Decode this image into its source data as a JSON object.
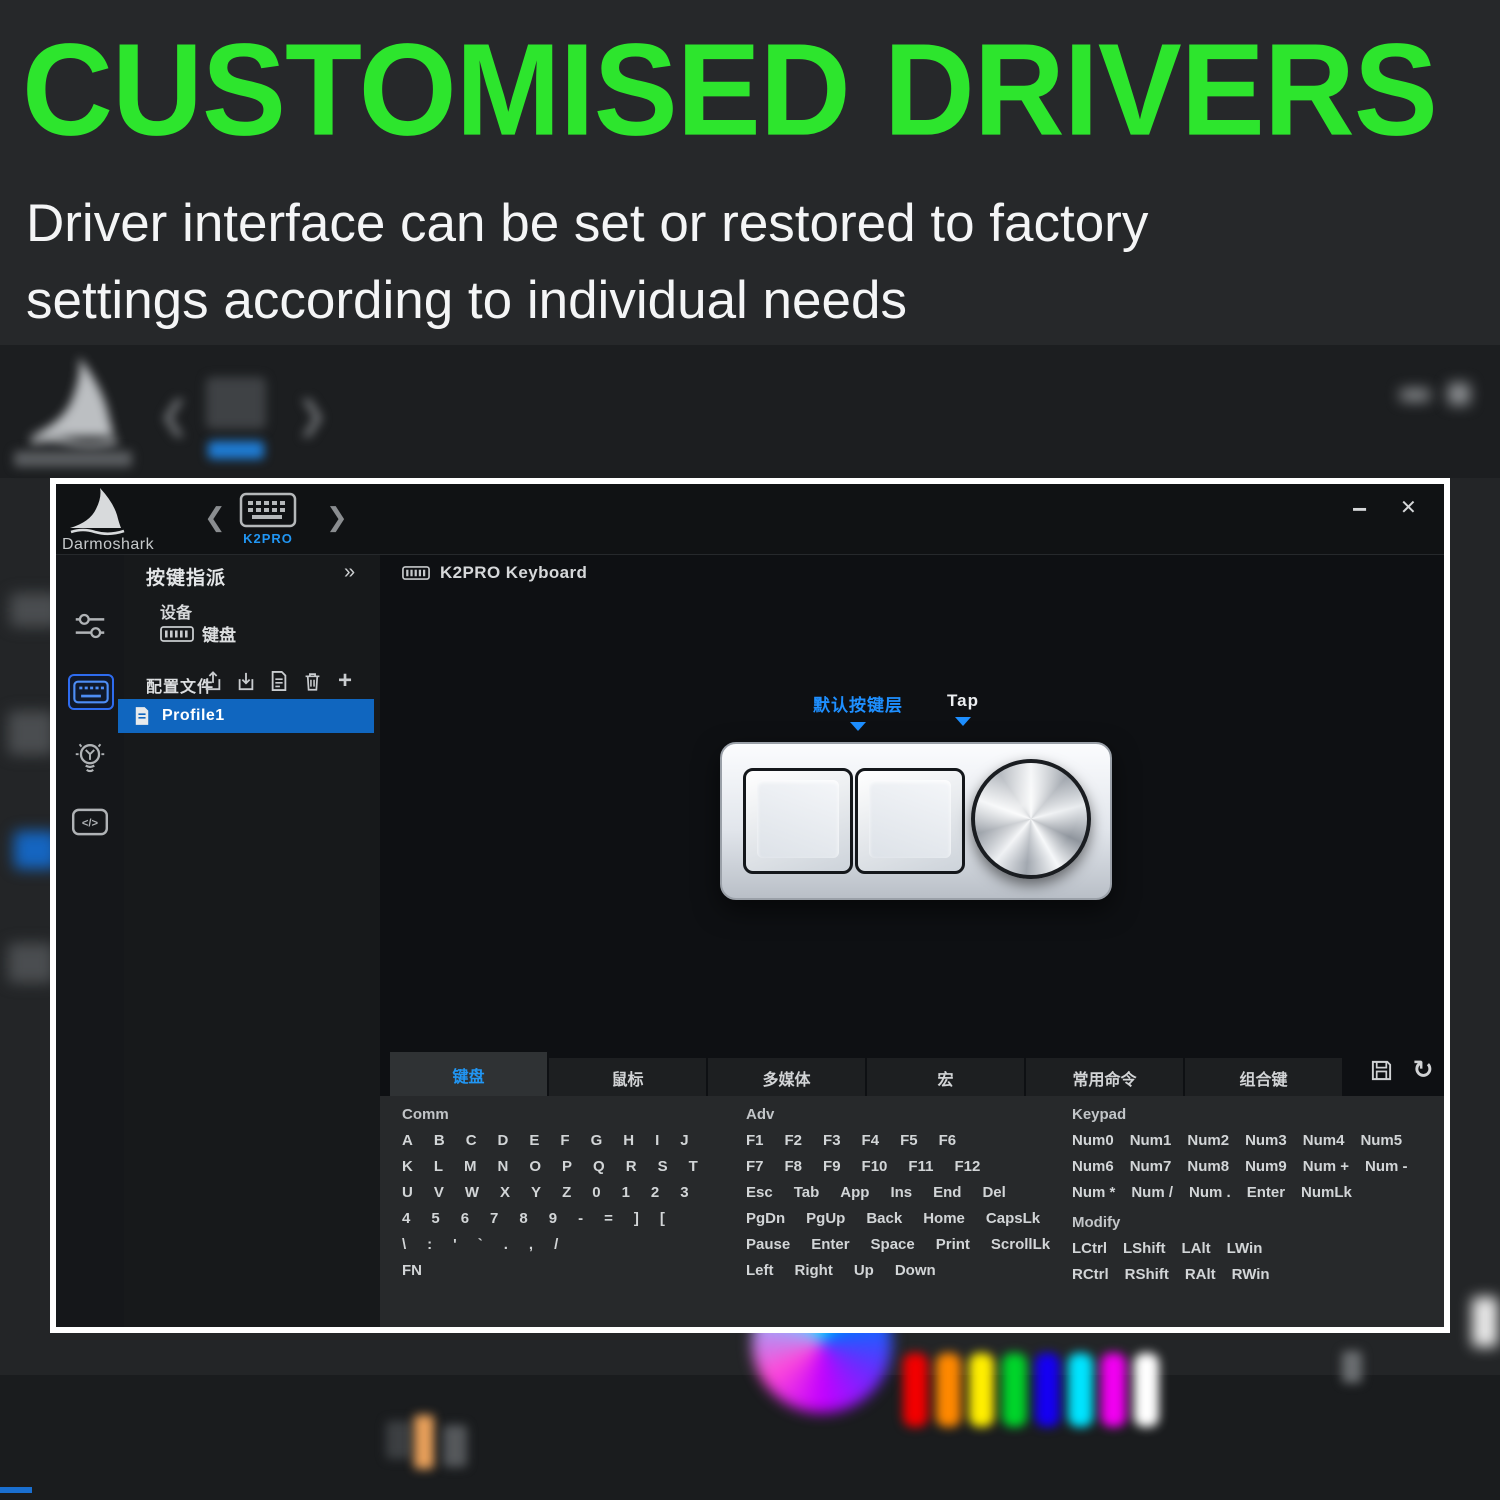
{
  "hero": {
    "headline": "CUSTOMISED DRIVERS",
    "subtitle_line1": "Driver interface can be set or restored to factory",
    "subtitle_line2": "settings according to individual needs"
  },
  "icons": {
    "prev": "❮",
    "next": "❯",
    "expand": "»",
    "minimize": "−",
    "close": "✕",
    "plus": "+",
    "refresh": "↻",
    "code_glyph": "</>"
  },
  "window": {
    "brand": "Darmoshark",
    "device_tab_label": "K2PRO",
    "panel": {
      "title": "按键指派",
      "device_section": "设备",
      "device_name": "键盘",
      "profiles_label": "配置文件",
      "profile_name": "Profile1"
    },
    "main": {
      "device_title": "K2PRO Keyboard",
      "layer_label": "默认按键层",
      "tap_label": "Tap"
    },
    "tabs": [
      {
        "label": "键盘",
        "active": true
      },
      {
        "label": "鼠标",
        "active": false
      },
      {
        "label": "多媒体",
        "active": false
      },
      {
        "label": "宏",
        "active": false
      },
      {
        "label": "常用命令",
        "active": false
      },
      {
        "label": "组合键",
        "active": false
      }
    ],
    "key_sections": [
      {
        "title": "Comm",
        "rows": [
          [
            "A",
            "B",
            "C",
            "D",
            "E",
            "F",
            "G",
            "H",
            "I",
            "J"
          ],
          [
            "K",
            "L",
            "M",
            "N",
            "O",
            "P",
            "Q",
            "R",
            "S",
            "T"
          ],
          [
            "U",
            "V",
            "W",
            "X",
            "Y",
            "Z",
            "0",
            "1",
            "2",
            "3"
          ],
          [
            "4",
            "5",
            "6",
            "7",
            "8",
            "9",
            "-",
            "=",
            "]",
            "["
          ],
          [
            "\\",
            ":",
            "'",
            "`",
            ".",
            ",",
            "/"
          ],
          [
            "FN"
          ]
        ]
      },
      {
        "title": "Adv",
        "rows": [
          [
            "F1",
            "F2",
            "F3",
            "F4",
            "F5",
            "F6"
          ],
          [
            "F7",
            "F8",
            "F9",
            "F10",
            "F11",
            "F12"
          ],
          [
            "Esc",
            "Tab",
            "App",
            "Ins",
            "End",
            "Del"
          ],
          [
            "PgDn",
            "PgUp",
            "Back",
            "Home",
            "CapsLk"
          ],
          [
            "Pause",
            "Enter",
            "Space",
            "Print",
            "ScrollLk"
          ],
          [
            "Left",
            "Right",
            "Up",
            "Down"
          ]
        ]
      },
      {
        "title": "Keypad",
        "rows": [
          [
            "Num0",
            "Num1",
            "Num2",
            "Num3",
            "Num4",
            "Num5"
          ],
          [
            "Num6",
            "Num7",
            "Num8",
            "Num9",
            "Num +",
            "Num -"
          ],
          [
            "Num *",
            "Num /",
            "Num .",
            "Enter",
            "NumLk"
          ]
        ],
        "sub": {
          "title": "Modify",
          "rows": [
            [
              "LCtrl",
              "LShift",
              "LAlt",
              "LWin"
            ],
            [
              "RCtrl",
              "RShift",
              "RAlt",
              "RWin"
            ]
          ]
        }
      }
    ]
  },
  "colors": {
    "headline_green": "#2de52d",
    "accent_blue": "#2196f3",
    "layer_blue": "#1e8fff",
    "profile_row_blue": "#1066bf"
  },
  "background": {
    "swatches": [
      "#f20000",
      "#ff8800",
      "#ffee00",
      "#00d42a",
      "#1500f2",
      "#00e4ff",
      "#f000f0",
      "#ffffff"
    ]
  }
}
